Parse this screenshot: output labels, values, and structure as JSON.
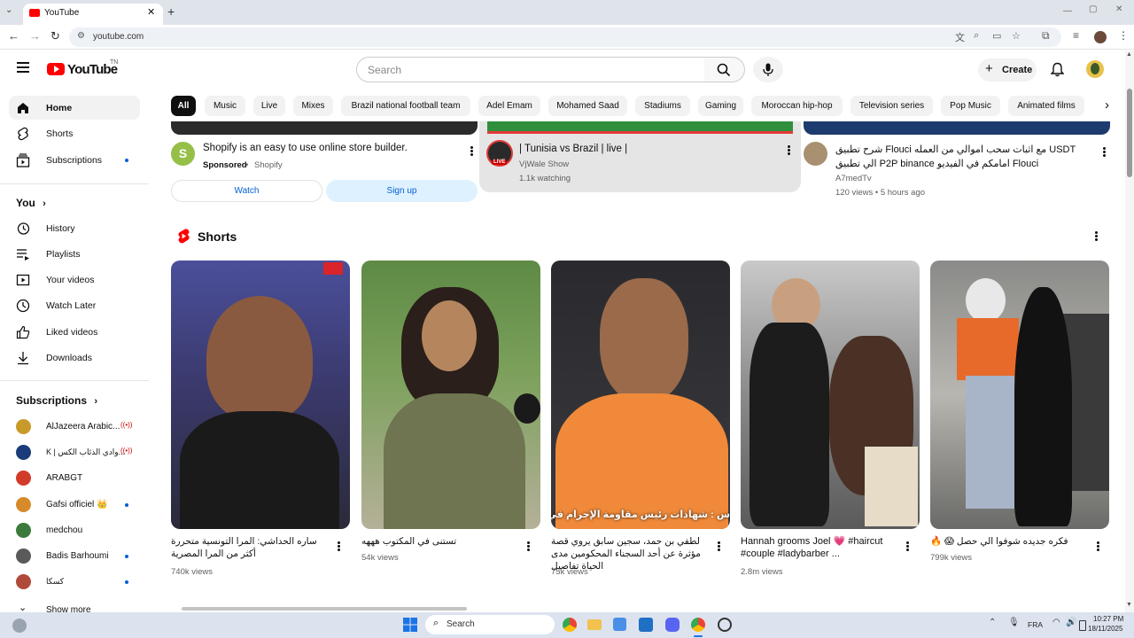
{
  "browser": {
    "tab_title": "YouTube",
    "url": "youtube.com"
  },
  "header": {
    "logo_text": "YouTube",
    "logo_sup": "TN",
    "search_placeholder": "Search",
    "create_label": "Create"
  },
  "sidebar": {
    "main": [
      {
        "label": "Home",
        "icon": "home-icon"
      },
      {
        "label": "Shorts",
        "icon": "shorts-icon"
      },
      {
        "label": "Subscriptions",
        "icon": "subscriptions-icon"
      }
    ],
    "you_heading": "You",
    "you": [
      {
        "label": "History",
        "icon": "history-icon"
      },
      {
        "label": "Playlists",
        "icon": "playlists-icon"
      },
      {
        "label": "Your videos",
        "icon": "your-videos-icon"
      },
      {
        "label": "Watch Later",
        "icon": "watch-later-icon"
      },
      {
        "label": "Liked videos",
        "icon": "like-icon"
      },
      {
        "label": "Downloads",
        "icon": "download-icon"
      }
    ],
    "subs_heading": "Subscriptions",
    "subscriptions": [
      {
        "label": "AlJazeera Arabic...",
        "badge": "live",
        "color": "#c89a2a"
      },
      {
        "label": "K | وادي الذئاب الكس...",
        "badge": "live",
        "color": "#1a3c7a"
      },
      {
        "label": "ARABGT",
        "badge": "",
        "color": "#d23a2a"
      },
      {
        "label": "Gafsi officiel 👑",
        "badge": "dot",
        "color": "#d78a2a"
      },
      {
        "label": "medchou",
        "badge": "",
        "color": "#3b7a3b"
      },
      {
        "label": "Badis Barhoumi",
        "badge": "dot",
        "color": "#5a5a5a"
      },
      {
        "label": "كسكا",
        "badge": "dot",
        "color": "#b04a3a"
      }
    ],
    "show_more": "Show more"
  },
  "chips": [
    "All",
    "Music",
    "Live",
    "Mixes",
    "Brazil national football team",
    "Adel Emam",
    "Mohamed Saad",
    "Stadiums",
    "Gaming",
    "Moroccan hip-hop",
    "Television series",
    "Pop Music",
    "Animated films"
  ],
  "top_row": {
    "ad": {
      "title": "Shopify is an easy to use online store builder.",
      "sponsored": "Sponsored",
      "advertiser": "Shopify",
      "watch_label": "Watch",
      "signup_label": "Sign up"
    },
    "live": {
      "title": "| Tunisia vs Brazil | live |",
      "channel": "VjWale Show",
      "stats": "1.1k watching",
      "live_badge": "LIVE"
    },
    "video3": {
      "title": "شرح تطبيق Flouci مع اثبات سحب اموالي من العمله USDT الي تطبيق P2P binance امامكم في الفيديو Flouci",
      "channel": "A7medTv",
      "stats": "120 views • 5 hours ago"
    }
  },
  "shorts": {
    "heading": "Shorts",
    "items": [
      {
        "title": "ساره الحداشي: المرا التونسية متحررة أكثر من المرا المصرية",
        "views": "740k views",
        "bg": "#5a4f8a"
      },
      {
        "title": "تستنى في المكتوب هههه",
        "views": "54k views",
        "bg": "#6f8d5a"
      },
      {
        "title": "لطفي بن حمد، سجين سابق يروي قصة مؤثرة عن أحد السجناء المحكومين مدى الحياة تفاصيل",
        "views": "75k views",
        "bg": "#c47a3a"
      },
      {
        "title": "Hannah grooms Joel 💗 #haircut #couple #ladybarber ...",
        "views": "2.8m views",
        "bg": "#8a8a8a"
      },
      {
        "title": "فكره جديده شوفوا الي حصل 😱 🔥",
        "views": "799k views",
        "bg": "#9a9a9a"
      }
    ]
  },
  "taskbar": {
    "search_label": "Search",
    "lang": "FRA",
    "time": "10:27 PM",
    "date": "18/11/2025"
  }
}
